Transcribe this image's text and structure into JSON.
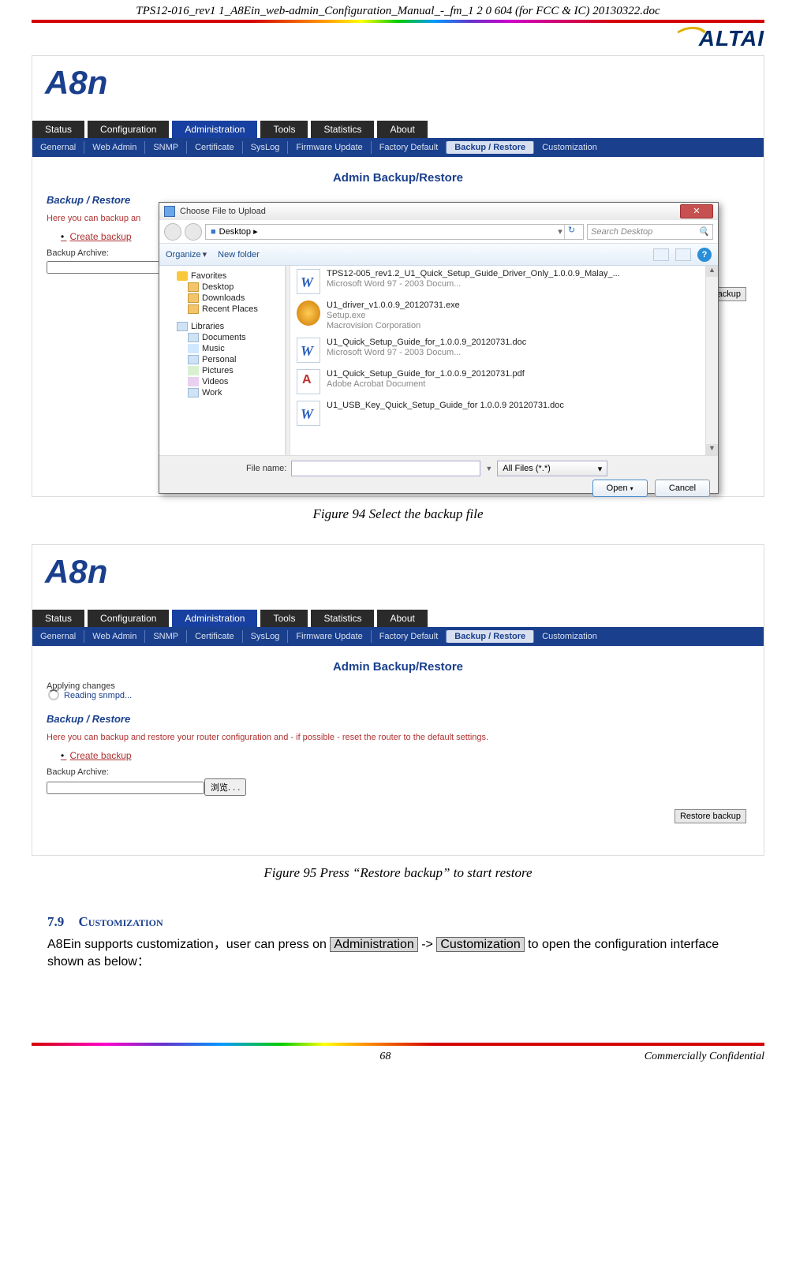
{
  "header": {
    "doc_title": "TPS12-016_rev1 1_A8Ein_web-admin_Configuration_Manual_-_fm_1 2 0 604 (for FCC & IC) 20130322.doc"
  },
  "brand": {
    "name": "ALTAI",
    "product": "A8n"
  },
  "tabs": [
    "Status",
    "Configuration",
    "Administration",
    "Tools",
    "Statistics",
    "About"
  ],
  "subtabs": [
    "Genernal",
    "Web Admin",
    "SNMP",
    "Certificate",
    "SysLog",
    "Firmware Update",
    "Factory Default",
    "Backup / Restore",
    "Customization"
  ],
  "panel": {
    "heading": "Admin Backup/Restore",
    "section_title": "Backup / Restore",
    "desc_short": "Here you can backup an",
    "desc_full": "Here you can backup and restore your router configuration and - if possible - reset the router to the default settings.",
    "create_link": "Create backup",
    "archive_label": "Backup Archive:",
    "browse_label": "浏览. . .",
    "restore_label": "Restore backup"
  },
  "applying": {
    "line1": "Applying changes",
    "line2": "Reading snmpd..."
  },
  "dialog": {
    "title": "Choose File to Upload",
    "location_icon": "■",
    "location": "Desktop  ▸",
    "search_placeholder": "Search Desktop",
    "organize": "Organize",
    "new_folder": "New folder",
    "favorites": "Favorites",
    "fav_items": [
      "Desktop",
      "Downloads",
      "Recent Places"
    ],
    "libraries": "Libraries",
    "lib_items": [
      "Documents",
      "Music",
      "Personal",
      "Pictures",
      "Videos",
      "Work"
    ],
    "files": [
      {
        "name": "TPS12-005_rev1.2_U1_Quick_Setup_Guide_Driver_Only_1.0.0.9_Malay_...",
        "sub": "Microsoft Word 97 - 2003 Docum...",
        "ico": "word"
      },
      {
        "name": "U1_driver_v1.0.0.9_20120731.exe",
        "sub": "Setup.exe\nMacrovision Corporation",
        "ico": "exe"
      },
      {
        "name": "U1_Quick_Setup_Guide_for_1.0.0.9_20120731.doc",
        "sub": "Microsoft Word 97 - 2003 Docum...",
        "ico": "word"
      },
      {
        "name": "U1_Quick_Setup_Guide_for_1.0.0.9_20120731.pdf",
        "sub": "Adobe Acrobat Document",
        "ico": "pdf"
      },
      {
        "name": "U1_USB_Key_Quick_Setup_Guide_for 1.0.0.9  20120731.doc",
        "sub": "",
        "ico": "word"
      }
    ],
    "filename_label": "File name:",
    "filetype": "All Files (*.*)",
    "open": "Open",
    "cancel": "Cancel"
  },
  "captions": {
    "fig94": "Figure 94 Select the backup file",
    "fig95": "Figure 95 Press “Restore backup” to start restore"
  },
  "section79": {
    "num": "7.9",
    "title": "Customization",
    "t1": "A8Ein supports customization，user can press on ",
    "btn1": "Administration",
    "arrow": " -> ",
    "btn2": "Customization",
    "t2": " to open the configuration interface shown as below："
  },
  "footer": {
    "page": "68",
    "conf": "Commercially Confidential"
  }
}
